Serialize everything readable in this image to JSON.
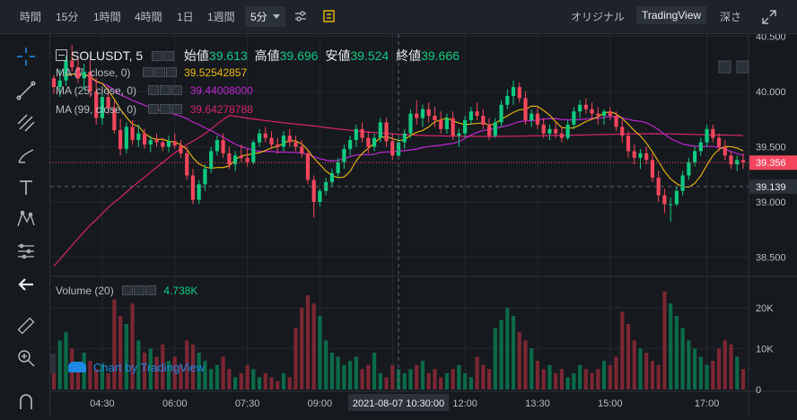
{
  "toolbar": {
    "items": [
      "時間",
      "15分",
      "1時間",
      "4時間",
      "1日",
      "1週間"
    ],
    "active": "5分",
    "right": [
      "オリジナル",
      "TradingView",
      "深さ"
    ]
  },
  "legend": {
    "symbol": "SOLUSDT, 5",
    "open_label": "始値",
    "open": "39.613",
    "high_label": "高値",
    "high": "39.696",
    "low_label": "安値",
    "low": "39.524",
    "close_label": "終値",
    "close": "39.666",
    "ma7_label": "MA (7, close, 0)",
    "ma7": "39.52542857",
    "ma25_label": "MA (25, close, 0)",
    "ma25": "39.44008000",
    "ma99_label": "MA (99, close, 0)",
    "ma99": "39.64278788",
    "volume_label": "Volume (20)",
    "volume": "4.738K"
  },
  "watermark": "Chart by TradingView",
  "colors": {
    "up": "#0ecb81",
    "down": "#f6465d",
    "ma7": "#f0b90b",
    "ma25": "#c026d3",
    "ma99": "#d6246e"
  },
  "chart_data": {
    "type": "candlestick",
    "price_axis": {
      "ticks": [
        "40.500",
        "40.000",
        "39.500",
        "39.000",
        "38.500"
      ],
      "range": [
        38.35,
        40.52
      ]
    },
    "price_markers": {
      "last": "39.356",
      "crosshair": "39.139"
    },
    "volume_axis": {
      "ticks": [
        "20K",
        "10K",
        "0"
      ],
      "range": [
        0,
        25000
      ]
    },
    "time_axis": {
      "ticks": [
        "04:30",
        "06:00",
        "07:30",
        "09:00",
        "10:30",
        "12:00",
        "13:30",
        "15:00",
        "17:00"
      ],
      "crosshair_label": "2021-08-07 10:30:00"
    },
    "candles": [
      [
        40.12,
        40.15,
        39.98,
        40.04
      ],
      [
        40.04,
        40.2,
        39.95,
        40.1
      ],
      [
        40.1,
        40.32,
        40.05,
        40.28
      ],
      [
        40.28,
        40.42,
        40.18,
        40.22
      ],
      [
        40.22,
        40.3,
        40.08,
        40.12
      ],
      [
        40.12,
        40.25,
        40.02,
        40.18
      ],
      [
        40.18,
        40.28,
        39.95,
        40.0
      ],
      [
        40.0,
        40.12,
        39.7,
        39.76
      ],
      [
        39.76,
        40.0,
        39.7,
        39.95
      ],
      [
        39.95,
        40.05,
        39.8,
        39.85
      ],
      [
        39.85,
        39.92,
        39.62,
        39.65
      ],
      [
        39.65,
        39.75,
        39.42,
        39.48
      ],
      [
        39.48,
        39.72,
        39.44,
        39.68
      ],
      [
        39.68,
        39.74,
        39.52,
        39.56
      ],
      [
        39.56,
        39.7,
        39.5,
        39.62
      ],
      [
        39.62,
        39.66,
        39.48,
        39.52
      ],
      [
        39.52,
        39.6,
        39.45,
        39.56
      ],
      [
        39.56,
        39.62,
        39.5,
        39.54
      ],
      [
        39.54,
        39.58,
        39.46,
        39.5
      ],
      [
        39.5,
        39.6,
        39.45,
        39.55
      ],
      [
        39.55,
        39.62,
        39.48,
        39.51
      ],
      [
        39.51,
        39.56,
        39.4,
        39.44
      ],
      [
        39.44,
        39.5,
        39.2,
        39.24
      ],
      [
        39.24,
        39.3,
        38.98,
        39.02
      ],
      [
        39.02,
        39.2,
        38.98,
        39.16
      ],
      [
        39.16,
        39.34,
        39.1,
        39.3
      ],
      [
        39.3,
        39.5,
        39.26,
        39.46
      ],
      [
        39.46,
        39.6,
        39.42,
        39.56
      ],
      [
        39.56,
        39.62,
        39.4,
        39.44
      ],
      [
        39.44,
        39.5,
        39.3,
        39.34
      ],
      [
        39.34,
        39.46,
        39.28,
        39.42
      ],
      [
        39.42,
        39.52,
        39.36,
        39.4
      ],
      [
        39.4,
        39.48,
        39.32,
        39.36
      ],
      [
        39.36,
        39.56,
        39.34,
        39.54
      ],
      [
        39.54,
        39.66,
        39.5,
        39.62
      ],
      [
        39.62,
        39.68,
        39.54,
        39.58
      ],
      [
        39.58,
        39.64,
        39.48,
        39.52
      ],
      [
        39.52,
        39.58,
        39.44,
        39.5
      ],
      [
        39.5,
        39.64,
        39.46,
        39.6
      ],
      [
        39.6,
        39.66,
        39.5,
        39.54
      ],
      [
        39.54,
        39.6,
        39.46,
        39.5
      ],
      [
        39.5,
        39.56,
        39.4,
        39.44
      ],
      [
        39.44,
        39.48,
        39.16,
        39.2
      ],
      [
        39.2,
        39.24,
        38.86,
        39.0
      ],
      [
        39.0,
        39.12,
        38.96,
        39.1
      ],
      [
        39.1,
        39.22,
        39.06,
        39.18
      ],
      [
        39.18,
        39.3,
        39.14,
        39.26
      ],
      [
        39.26,
        39.4,
        39.22,
        39.36
      ],
      [
        39.36,
        39.52,
        39.3,
        39.48
      ],
      [
        39.48,
        39.6,
        39.42,
        39.56
      ],
      [
        39.56,
        39.7,
        39.5,
        39.66
      ],
      [
        39.66,
        39.72,
        39.54,
        39.58
      ],
      [
        39.58,
        39.64,
        39.44,
        39.5
      ],
      [
        39.5,
        39.62,
        39.46,
        39.58
      ],
      [
        39.58,
        39.76,
        39.54,
        39.72
      ],
      [
        39.72,
        39.76,
        39.5,
        39.55
      ],
      [
        39.55,
        39.62,
        39.38,
        39.42
      ],
      [
        39.42,
        39.58,
        39.4,
        39.54
      ],
      [
        39.54,
        39.66,
        39.48,
        39.62
      ],
      [
        39.62,
        39.84,
        39.58,
        39.8
      ],
      [
        39.8,
        39.92,
        39.7,
        39.76
      ],
      [
        39.76,
        39.88,
        39.68,
        39.84
      ],
      [
        39.84,
        39.9,
        39.72,
        39.78
      ],
      [
        39.78,
        39.86,
        39.68,
        39.74
      ],
      [
        39.74,
        39.82,
        39.62,
        39.66
      ],
      [
        39.66,
        39.8,
        39.62,
        39.76
      ],
      [
        39.76,
        39.82,
        39.56,
        39.6
      ],
      [
        39.6,
        39.66,
        39.5,
        39.62
      ],
      [
        39.62,
        39.78,
        39.58,
        39.74
      ],
      [
        39.74,
        39.86,
        39.7,
        39.82
      ],
      [
        39.82,
        39.9,
        39.74,
        39.78
      ],
      [
        39.78,
        39.84,
        39.66,
        39.7
      ],
      [
        39.7,
        39.76,
        39.56,
        39.6
      ],
      [
        39.6,
        39.76,
        39.58,
        39.72
      ],
      [
        39.72,
        39.92,
        39.68,
        39.88
      ],
      [
        39.88,
        40.02,
        39.84,
        39.96
      ],
      [
        39.96,
        40.1,
        39.88,
        40.04
      ],
      [
        40.04,
        40.08,
        39.9,
        39.94
      ],
      [
        39.94,
        40.0,
        39.7,
        39.74
      ],
      [
        39.74,
        39.84,
        39.68,
        39.8
      ],
      [
        39.8,
        39.86,
        39.66,
        39.7
      ],
      [
        39.7,
        39.76,
        39.58,
        39.62
      ],
      [
        39.62,
        39.7,
        39.56,
        39.66
      ],
      [
        39.66,
        39.72,
        39.58,
        39.62
      ],
      [
        39.62,
        39.68,
        39.54,
        39.58
      ],
      [
        39.58,
        39.74,
        39.56,
        39.7
      ],
      [
        39.7,
        39.86,
        39.66,
        39.82
      ],
      [
        39.82,
        39.92,
        39.76,
        39.88
      ],
      [
        39.88,
        39.94,
        39.8,
        39.84
      ],
      [
        39.84,
        39.9,
        39.74,
        39.8
      ],
      [
        39.8,
        39.86,
        39.7,
        39.78
      ],
      [
        39.78,
        39.84,
        39.7,
        39.82
      ],
      [
        39.82,
        39.86,
        39.74,
        39.78
      ],
      [
        39.78,
        39.82,
        39.64,
        39.68
      ],
      [
        39.68,
        39.74,
        39.54,
        39.6
      ],
      [
        39.6,
        39.64,
        39.4,
        39.46
      ],
      [
        39.46,
        39.52,
        39.34,
        39.4
      ],
      [
        39.4,
        39.48,
        39.3,
        39.44
      ],
      [
        39.44,
        39.5,
        39.34,
        39.38
      ],
      [
        39.38,
        39.44,
        39.18,
        39.22
      ],
      [
        39.22,
        39.28,
        39.0,
        39.06
      ],
      [
        39.06,
        39.12,
        38.9,
        38.98
      ],
      [
        38.98,
        39.04,
        38.82,
        38.98
      ],
      [
        38.98,
        39.14,
        38.96,
        39.1
      ],
      [
        39.1,
        39.28,
        39.06,
        39.24
      ],
      [
        39.24,
        39.4,
        39.2,
        39.36
      ],
      [
        39.36,
        39.5,
        39.32,
        39.46
      ],
      [
        39.46,
        39.58,
        39.42,
        39.54
      ],
      [
        39.54,
        39.7,
        39.5,
        39.66
      ],
      [
        39.66,
        39.7,
        39.54,
        39.58
      ],
      [
        39.58,
        39.62,
        39.46,
        39.5
      ],
      [
        39.5,
        39.56,
        39.38,
        39.42
      ],
      [
        39.42,
        39.46,
        39.3,
        39.34
      ],
      [
        39.34,
        39.42,
        39.28,
        39.38
      ],
      [
        39.38,
        39.44,
        39.3,
        39.36
      ]
    ],
    "volumes": [
      8000,
      12000,
      14000,
      10000,
      6000,
      9000,
      7000,
      5000,
      6000,
      4000,
      22000,
      18000,
      16000,
      21000,
      12000,
      9000,
      10000,
      8000,
      11000,
      7000,
      8000,
      6000,
      12000,
      11000,
      9000,
      7000,
      5000,
      6000,
      8000,
      5000,
      3000,
      4000,
      6000,
      5000,
      3000,
      4000,
      3000,
      2000,
      4000,
      3000,
      15000,
      20000,
      23000,
      21000,
      18000,
      12000,
      9000,
      8000,
      6000,
      7000,
      8000,
      5000,
      6000,
      9000,
      4000,
      3000,
      6000,
      5000,
      4000,
      5000,
      6000,
      7000,
      4000,
      5000,
      3000,
      4000,
      5000,
      6000,
      4000,
      3000,
      8000,
      6000,
      5000,
      15000,
      17000,
      20000,
      18000,
      14000,
      12000,
      10000,
      7000,
      5000,
      6000,
      4000,
      5000,
      3000,
      4000,
      6000,
      5000,
      4000,
      5000,
      7000,
      6000,
      8000,
      19000,
      16000,
      12000,
      10000,
      9000,
      7000,
      6000,
      24000,
      21000,
      18000,
      15000,
      12000,
      10000,
      8000,
      6000,
      7000,
      10000,
      12000,
      11000,
      8000,
      5000
    ]
  }
}
